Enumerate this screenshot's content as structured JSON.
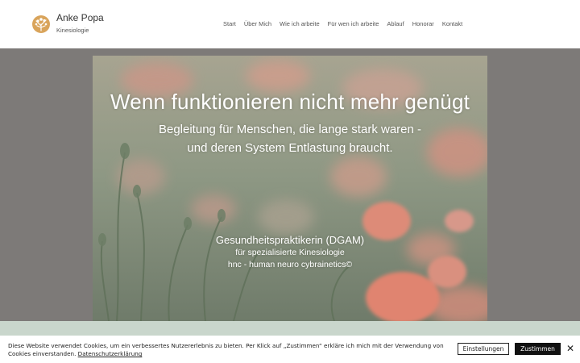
{
  "brand": {
    "name": "Anke Popa",
    "subtitle": "Kinesiologie",
    "logo_icon": "tree-logo-icon",
    "logo_color": "#d9a45b"
  },
  "nav": {
    "items": [
      "Start",
      "Über Mich",
      "Wie ich arbeite",
      "Für wen ich arbeite",
      "Ablauf",
      "Honorar",
      "Kontakt"
    ]
  },
  "hero": {
    "headline": "Wenn funktionieren nicht mehr genügt",
    "subline_1": "Begleitung für Menschen, die lange stark waren -",
    "subline_2": "und deren System Entlastung braucht.",
    "credential_1": "Gesundheitspraktikerin (DGAM)",
    "credential_2": "für spezialisierte Kinesiologie",
    "credential_3": "hnc - human neuro cybrainetics©",
    "image_subject": "poppy-field",
    "colors": {
      "band": "#7d7a78",
      "poppies": "#d98c7c",
      "foliage": "#8d9786"
    }
  },
  "cookie_banner": {
    "text_main": "Diese Website verwendet Cookies, um ein verbessertes Nutzererlebnis zu bieten. Per Klick auf „Zustimmen“ erkläre ich mich mit der Verwendung von Cookies einverstanden. ",
    "policy_link": "Datenschutzerklärung",
    "settings_label": "Einstellungen",
    "accept_label": "Zustimmen",
    "close_icon": "close-icon"
  }
}
